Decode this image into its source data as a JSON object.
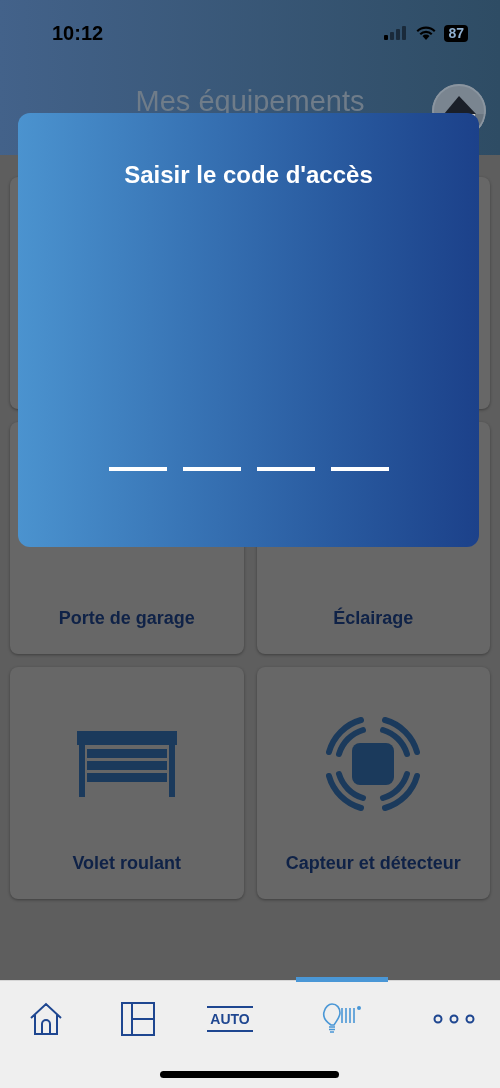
{
  "status_bar": {
    "time": "10:12",
    "battery": "87"
  },
  "header": {
    "title": "Mes équipements"
  },
  "cards": [
    {
      "kind": "blank"
    },
    {
      "kind": "blank"
    },
    {
      "kind": "garage",
      "label": "Porte de garage"
    },
    {
      "kind": "lighting",
      "label": "Éclairage"
    },
    {
      "kind": "shutter",
      "label": "Volet roulant"
    },
    {
      "kind": "sensor",
      "label": "Capteur et détecteur"
    }
  ],
  "dialog": {
    "title": "Saisir le code d'accès",
    "digits": [
      {
        "filled": false
      },
      {
        "filled": false
      },
      {
        "filled": false
      },
      {
        "filled": false
      }
    ]
  },
  "tab_bar": [
    {
      "kind": "home",
      "selected": false
    },
    {
      "kind": "floorplan",
      "selected": false
    },
    {
      "kind": "auto",
      "label": "AUTO",
      "selected": false
    },
    {
      "kind": "lighting",
      "selected": true
    },
    {
      "kind": "more",
      "selected": false
    }
  ]
}
